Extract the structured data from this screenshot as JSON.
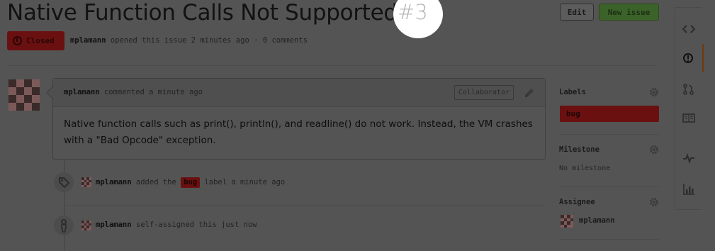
{
  "issue": {
    "title": "Native Function Calls Not Supported",
    "number": "#3",
    "state": "Closed",
    "author": "mplamann",
    "opened_text": "opened this issue 2 minutes ago · 0 comments"
  },
  "header": {
    "edit_label": "Edit",
    "new_issue_label": "New issue"
  },
  "comment": {
    "author": "mplamann",
    "time_text": "commented a minute ago",
    "role_badge": "Collaborator",
    "body": "Native function calls such as print(), println(), and readline() do not work. Instead, the VM crashes with a \"Bad Opcode\" exception."
  },
  "timeline": [
    {
      "icon": "tag-icon",
      "author": "mplamann",
      "pre": "added the",
      "label": "bug",
      "post": "label a minute ago"
    },
    {
      "icon": "person-icon",
      "author": "mplamann",
      "text": "self-assigned this just now"
    }
  ],
  "sidebar": {
    "labels_heading": "Labels",
    "labels": [
      "bug"
    ],
    "milestone_heading": "Milestone",
    "milestone_value": "No milestone",
    "assignee_heading": "Assignee",
    "assignee": "mplamann"
  },
  "right_nav": [
    "code-icon",
    "issues-icon",
    "pull-requests-icon",
    "wiki-icon",
    "pulse-icon",
    "graphs-icon"
  ],
  "colors": {
    "closed_badge": "#6a1010",
    "new_issue_button": "#3b6329",
    "label_bug": "#6a1010",
    "active_nav_accent": "#6e3a10"
  }
}
